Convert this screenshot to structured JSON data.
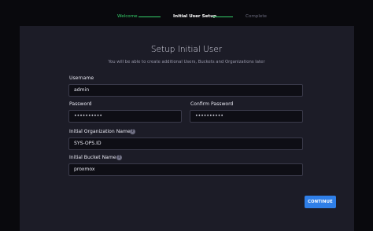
{
  "stepper": {
    "steps": [
      {
        "label": "Welcome",
        "state": "done"
      },
      {
        "label": "Initial User Setup",
        "state": "current"
      },
      {
        "label": "Complete",
        "state": "pending"
      }
    ]
  },
  "form": {
    "title": "Setup Initial User",
    "subtitle": "You will be able to create additional Users, Buckets and Organizations later",
    "username_label": "Username",
    "username_value": "admin",
    "password_label": "Password",
    "password_value": "••••••••••",
    "confirm_password_label": "Confirm Password",
    "confirm_password_value": "••••••••••",
    "org_label": "Initial Organization Name",
    "org_value": "SYS-OPS.ID",
    "bucket_label": "Initial Bucket Name",
    "bucket_value": "proxmox",
    "help_glyph": "?",
    "continue_label": "CONTINUE"
  },
  "colors": {
    "step_done": "#35d06a",
    "step_pending": "#6a6a7c",
    "accent": "#2f7fe8"
  }
}
